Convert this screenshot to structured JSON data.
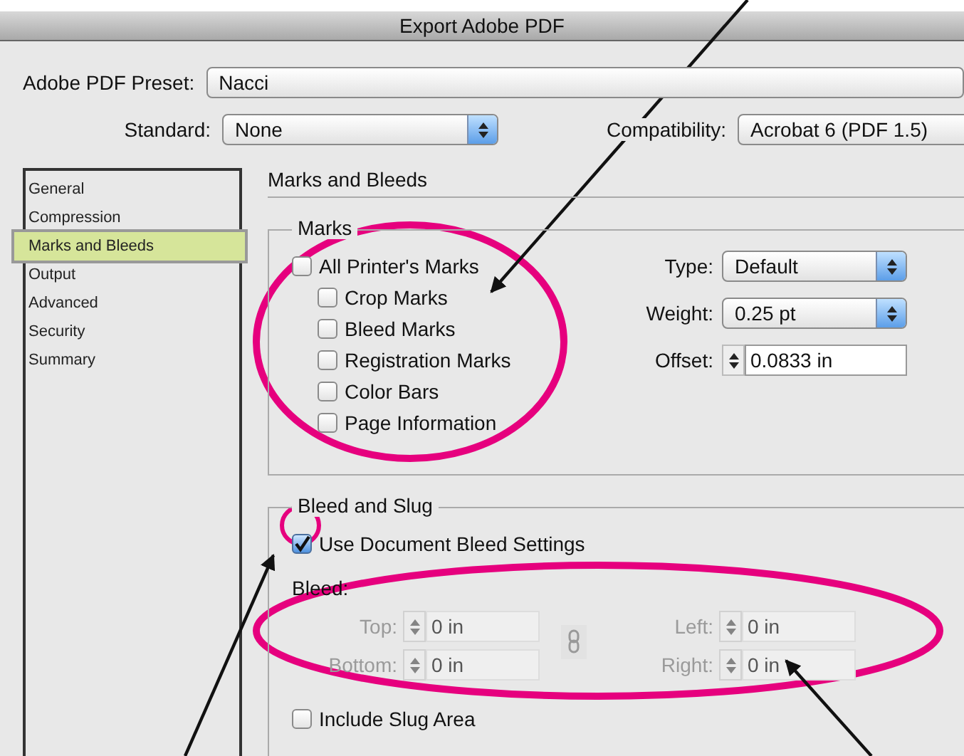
{
  "window": {
    "title": "Export Adobe PDF"
  },
  "preset": {
    "label": "Adobe PDF Preset:",
    "value": "Nacci"
  },
  "standard": {
    "label": "Standard:",
    "value": "None"
  },
  "compatibility": {
    "label": "Compatibility:",
    "value": "Acrobat 6 (PDF 1.5)"
  },
  "sidebar": {
    "items": [
      {
        "label": "General",
        "selected": false
      },
      {
        "label": "Compression",
        "selected": false
      },
      {
        "label": "Marks and Bleeds",
        "selected": true
      },
      {
        "label": "Output",
        "selected": false
      },
      {
        "label": "Advanced",
        "selected": false
      },
      {
        "label": "Security",
        "selected": false
      },
      {
        "label": "Summary",
        "selected": false
      }
    ]
  },
  "panel": {
    "title": "Marks and Bleeds"
  },
  "marks": {
    "title": "Marks",
    "checkboxes": [
      {
        "label": "All Printer's Marks",
        "checked": false,
        "children": [
          {
            "label": "Crop Marks",
            "checked": false
          },
          {
            "label": "Bleed Marks",
            "checked": false
          },
          {
            "label": "Registration Marks",
            "checked": false
          },
          {
            "label": "Color Bars",
            "checked": false
          },
          {
            "label": "Page Information",
            "checked": false
          }
        ]
      }
    ],
    "type": {
      "label": "Type:",
      "value": "Default"
    },
    "weight": {
      "label": "Weight:",
      "value": "0.25 pt"
    },
    "offset": {
      "label": "Offset:",
      "value": "0.0833 in"
    }
  },
  "bleed_and_slug": {
    "title": "Bleed and Slug",
    "use_document_bleed": {
      "label": "Use Document Bleed Settings",
      "checked": true
    },
    "bleed_label": "Bleed:",
    "fields": [
      {
        "label": "Top:",
        "value": "0 in",
        "disabled": true
      },
      {
        "label": "Left:",
        "value": "0 in",
        "disabled": true
      },
      {
        "label": "Bottom:",
        "value": "0 in",
        "disabled": true
      },
      {
        "label": "Right:",
        "value": "0 in",
        "disabled": true
      }
    ],
    "include_slug": {
      "label": "Include Slug Area",
      "checked": false
    }
  }
}
